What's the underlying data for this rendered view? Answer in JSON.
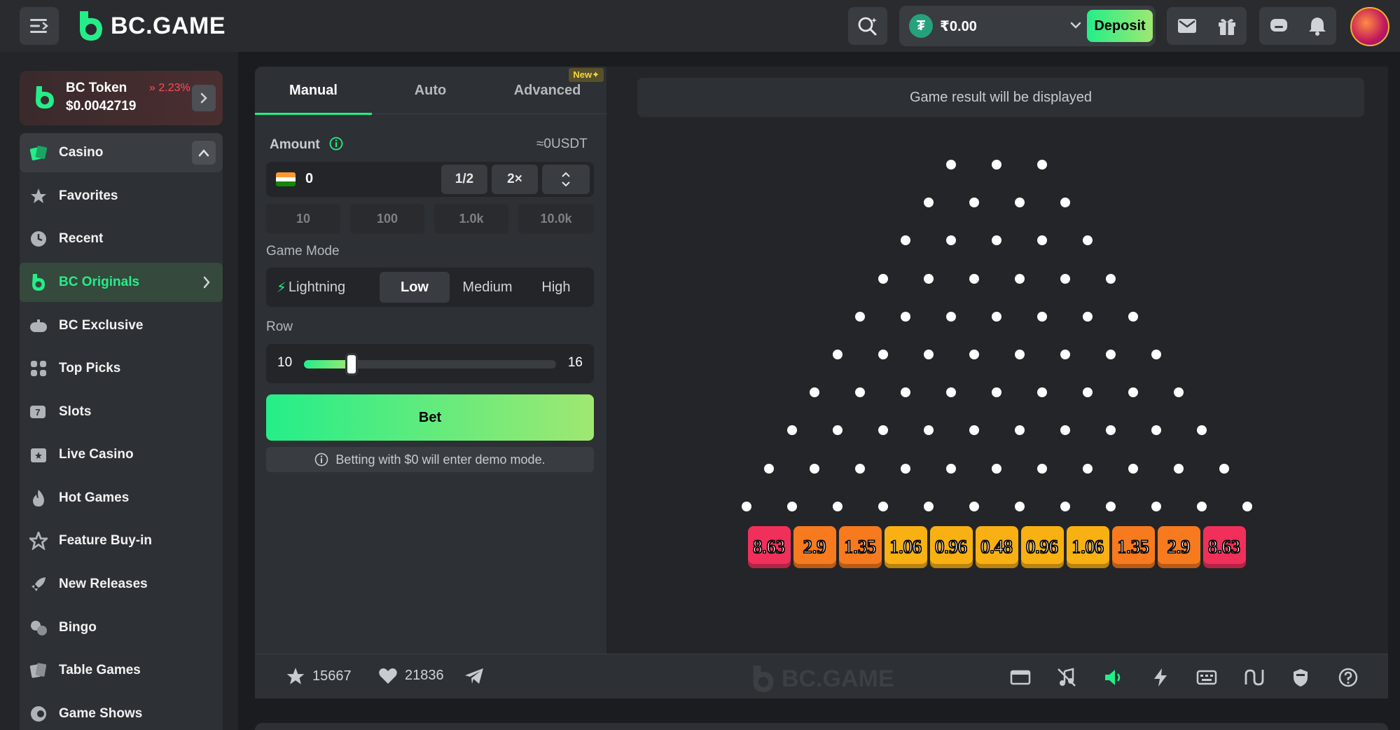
{
  "header": {
    "logo_text": "BC.GAME",
    "balance": "₹0.00",
    "deposit_label": "Deposit",
    "accent": "#24ee89"
  },
  "sidebar": {
    "token": {
      "name": "BC Token",
      "change": "2.23%",
      "price": "$0.0042719"
    },
    "items": [
      {
        "label": "Casino",
        "icon": "casino-icon"
      },
      {
        "label": "Favorites",
        "icon": "star-icon"
      },
      {
        "label": "Recent",
        "icon": "clock-icon"
      },
      {
        "label": "BC Originals",
        "icon": "bc-originals-icon"
      },
      {
        "label": "BC Exclusive",
        "icon": "gamepad-icon"
      },
      {
        "label": "Top Picks",
        "icon": "grid-icon"
      },
      {
        "label": "Slots",
        "icon": "slots-icon"
      },
      {
        "label": "Live Casino",
        "icon": "live-casino-icon"
      },
      {
        "label": "Hot Games",
        "icon": "fire-icon"
      },
      {
        "label": "Feature Buy-in",
        "icon": "feature-star-icon"
      },
      {
        "label": "New Releases",
        "icon": "rocket-icon"
      },
      {
        "label": "Bingo",
        "icon": "bingo-icon"
      },
      {
        "label": "Table Games",
        "icon": "cards-icon"
      },
      {
        "label": "Game Shows",
        "icon": "game-shows-icon"
      }
    ]
  },
  "panel": {
    "tabs": [
      "Manual",
      "Auto",
      "Advanced"
    ],
    "new_badge": "New",
    "amount_label": "Amount",
    "amount_usdt": "≈0USDT",
    "amount_value": "0",
    "half_label": "1/2",
    "double_label": "2×",
    "quick_amounts": [
      "10",
      "100",
      "1.0k",
      "10.0k"
    ],
    "game_mode_label": "Game Mode",
    "modes": [
      "Lightning",
      "Low",
      "Medium",
      "High"
    ],
    "active_mode": "Low",
    "row_label": "Row",
    "row_min": "10",
    "row_max": "16",
    "row_value": 10,
    "bet_label": "Bet",
    "demo_note": "Betting with $0 will enter demo mode."
  },
  "game": {
    "result_text": "Game result will be displayed",
    "rows": 10,
    "multipliers": [
      "8.63",
      "2.9",
      "1.35",
      "1.06",
      "0.96",
      "0.48",
      "0.96",
      "1.06",
      "1.35",
      "2.9",
      "8.63"
    ],
    "multiplier_colors": [
      "#f0305b",
      "#f77a1e",
      "#f77a1e",
      "#f9b012",
      "#f9b012",
      "#f9b012",
      "#f9b012",
      "#f9b012",
      "#f77a1e",
      "#f77a1e",
      "#f0305b"
    ]
  },
  "bottom": {
    "favorites_count": "15667",
    "likes_count": "21836",
    "watermark": "BC.GAME"
  }
}
